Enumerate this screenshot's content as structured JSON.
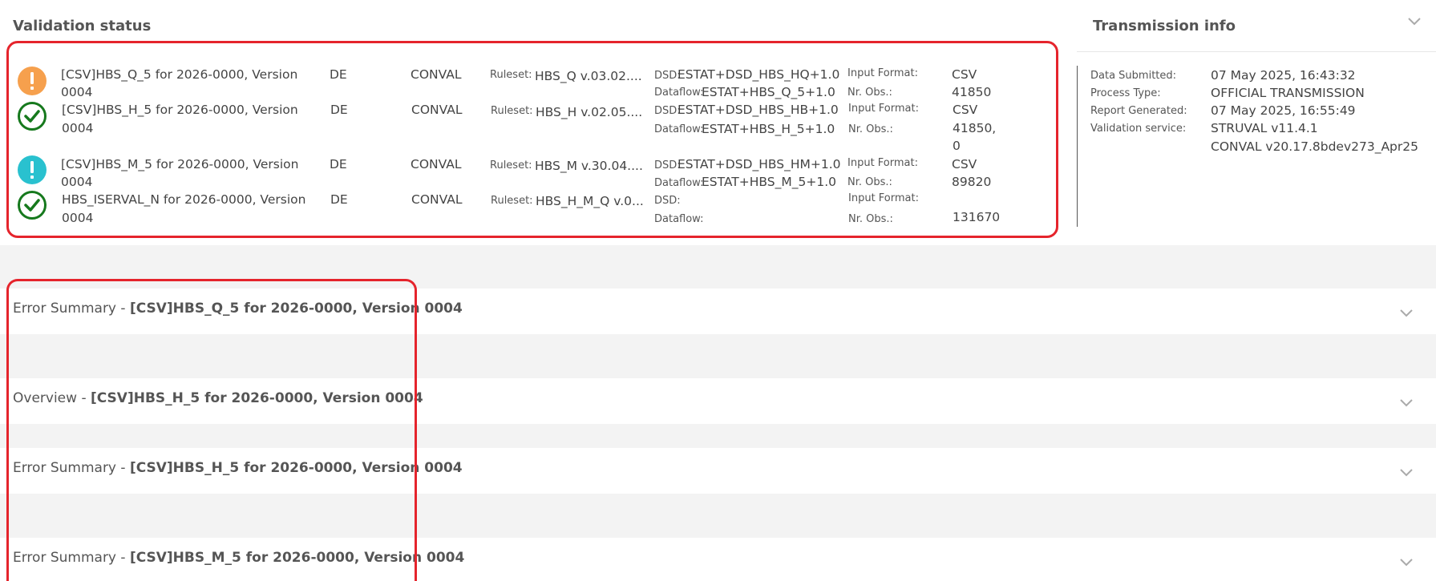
{
  "validation": {
    "title": "Validation status",
    "rows": [
      {
        "status": "warning",
        "name_line1": "[CSV]HBS_Q_5 for 2026-0000, Version",
        "name_line2": "0004",
        "country": "DE",
        "service": "CONVAL",
        "ruleset_label": "Ruleset:",
        "ruleset": "HBS_Q v.03.02....",
        "dsd_label": "DSD:",
        "dsd": "ESTAT+DSD_HBS_HQ+1.0",
        "dataflow_label": "Dataflow:",
        "dataflow": "ESTAT+HBS_Q_5+1.0",
        "input_format_label": "Input Format:",
        "input_format": "CSV",
        "nr_obs_label": "Nr. Obs.:",
        "nr_obs_line1": "41850",
        "nr_obs_line2": ""
      },
      {
        "status": "ok",
        "name_line1": "[CSV]HBS_H_5 for 2026-0000, Version",
        "name_line2": "0004",
        "country": "DE",
        "service": "CONVAL",
        "ruleset_label": "Ruleset:",
        "ruleset": "HBS_H v.02.05....",
        "dsd_label": "DSD:",
        "dsd": "ESTAT+DSD_HBS_HB+1.0",
        "dataflow_label": "Dataflow:",
        "dataflow": "ESTAT+HBS_H_5+1.0",
        "input_format_label": "Input Format:",
        "input_format": "CSV",
        "nr_obs_label": "Nr. Obs.:",
        "nr_obs_line1": "41850,",
        "nr_obs_line2": "0"
      },
      {
        "status": "info",
        "name_line1": "[CSV]HBS_M_5 for 2026-0000, Version",
        "name_line2": "0004",
        "country": "DE",
        "service": "CONVAL",
        "ruleset_label": "Ruleset:",
        "ruleset": "HBS_M v.30.04....",
        "dsd_label": "DSD:",
        "dsd": "ESTAT+DSD_HBS_HM+1.0",
        "dataflow_label": "Dataflow:",
        "dataflow": "ESTAT+HBS_M_5+1.0",
        "input_format_label": "Input Format:",
        "input_format": "CSV",
        "nr_obs_label": "Nr. Obs.:",
        "nr_obs_line1": "89820",
        "nr_obs_line2": ""
      },
      {
        "status": "ok",
        "name_line1": "HBS_ISERVAL_N for 2026-0000, Version",
        "name_line2": "0004",
        "country": "DE",
        "service": "CONVAL",
        "ruleset_label": "Ruleset:",
        "ruleset": "HBS_H_M_Q v.0...",
        "dsd_label": "DSD:",
        "dsd": "",
        "dataflow_label": "Dataflow:",
        "dataflow": "",
        "input_format_label": "Input Format:",
        "input_format": "",
        "nr_obs_label": "Nr. Obs.:",
        "nr_obs_line1": "131670",
        "nr_obs_line2": ""
      }
    ]
  },
  "transmission": {
    "title": "Transmission info",
    "items": [
      {
        "label": "Data Submitted:",
        "value": "07 May 2025, 16:43:32"
      },
      {
        "label": "Process Type:",
        "value": "OFFICIAL TRANSMISSION"
      },
      {
        "label": "Report Generated:",
        "value": "07 May 2025, 16:55:49"
      },
      {
        "label": "Validation service:",
        "value": "STRUVAL v11.4.1",
        "value2": "CONVAL v20.17.8bdev273_Apr25"
      }
    ]
  },
  "sections": [
    {
      "prefix": "Error Summary - ",
      "title": "[CSV]HBS_Q_5 for 2026-0000, Version 0004"
    },
    {
      "prefix": "Overview - ",
      "title": "[CSV]HBS_H_5 for 2026-0000, Version 0004"
    },
    {
      "prefix": "Error Summary - ",
      "title": "[CSV]HBS_H_5 for 2026-0000, Version 0004"
    },
    {
      "prefix": "Error Summary - ",
      "title": "[CSV]HBS_M_5 for 2026-0000, Version 0004"
    }
  ],
  "colors": {
    "warning": "#f6a04d",
    "info": "#29c1cf",
    "ok": "#16791d",
    "highlight": "#e5242c"
  }
}
